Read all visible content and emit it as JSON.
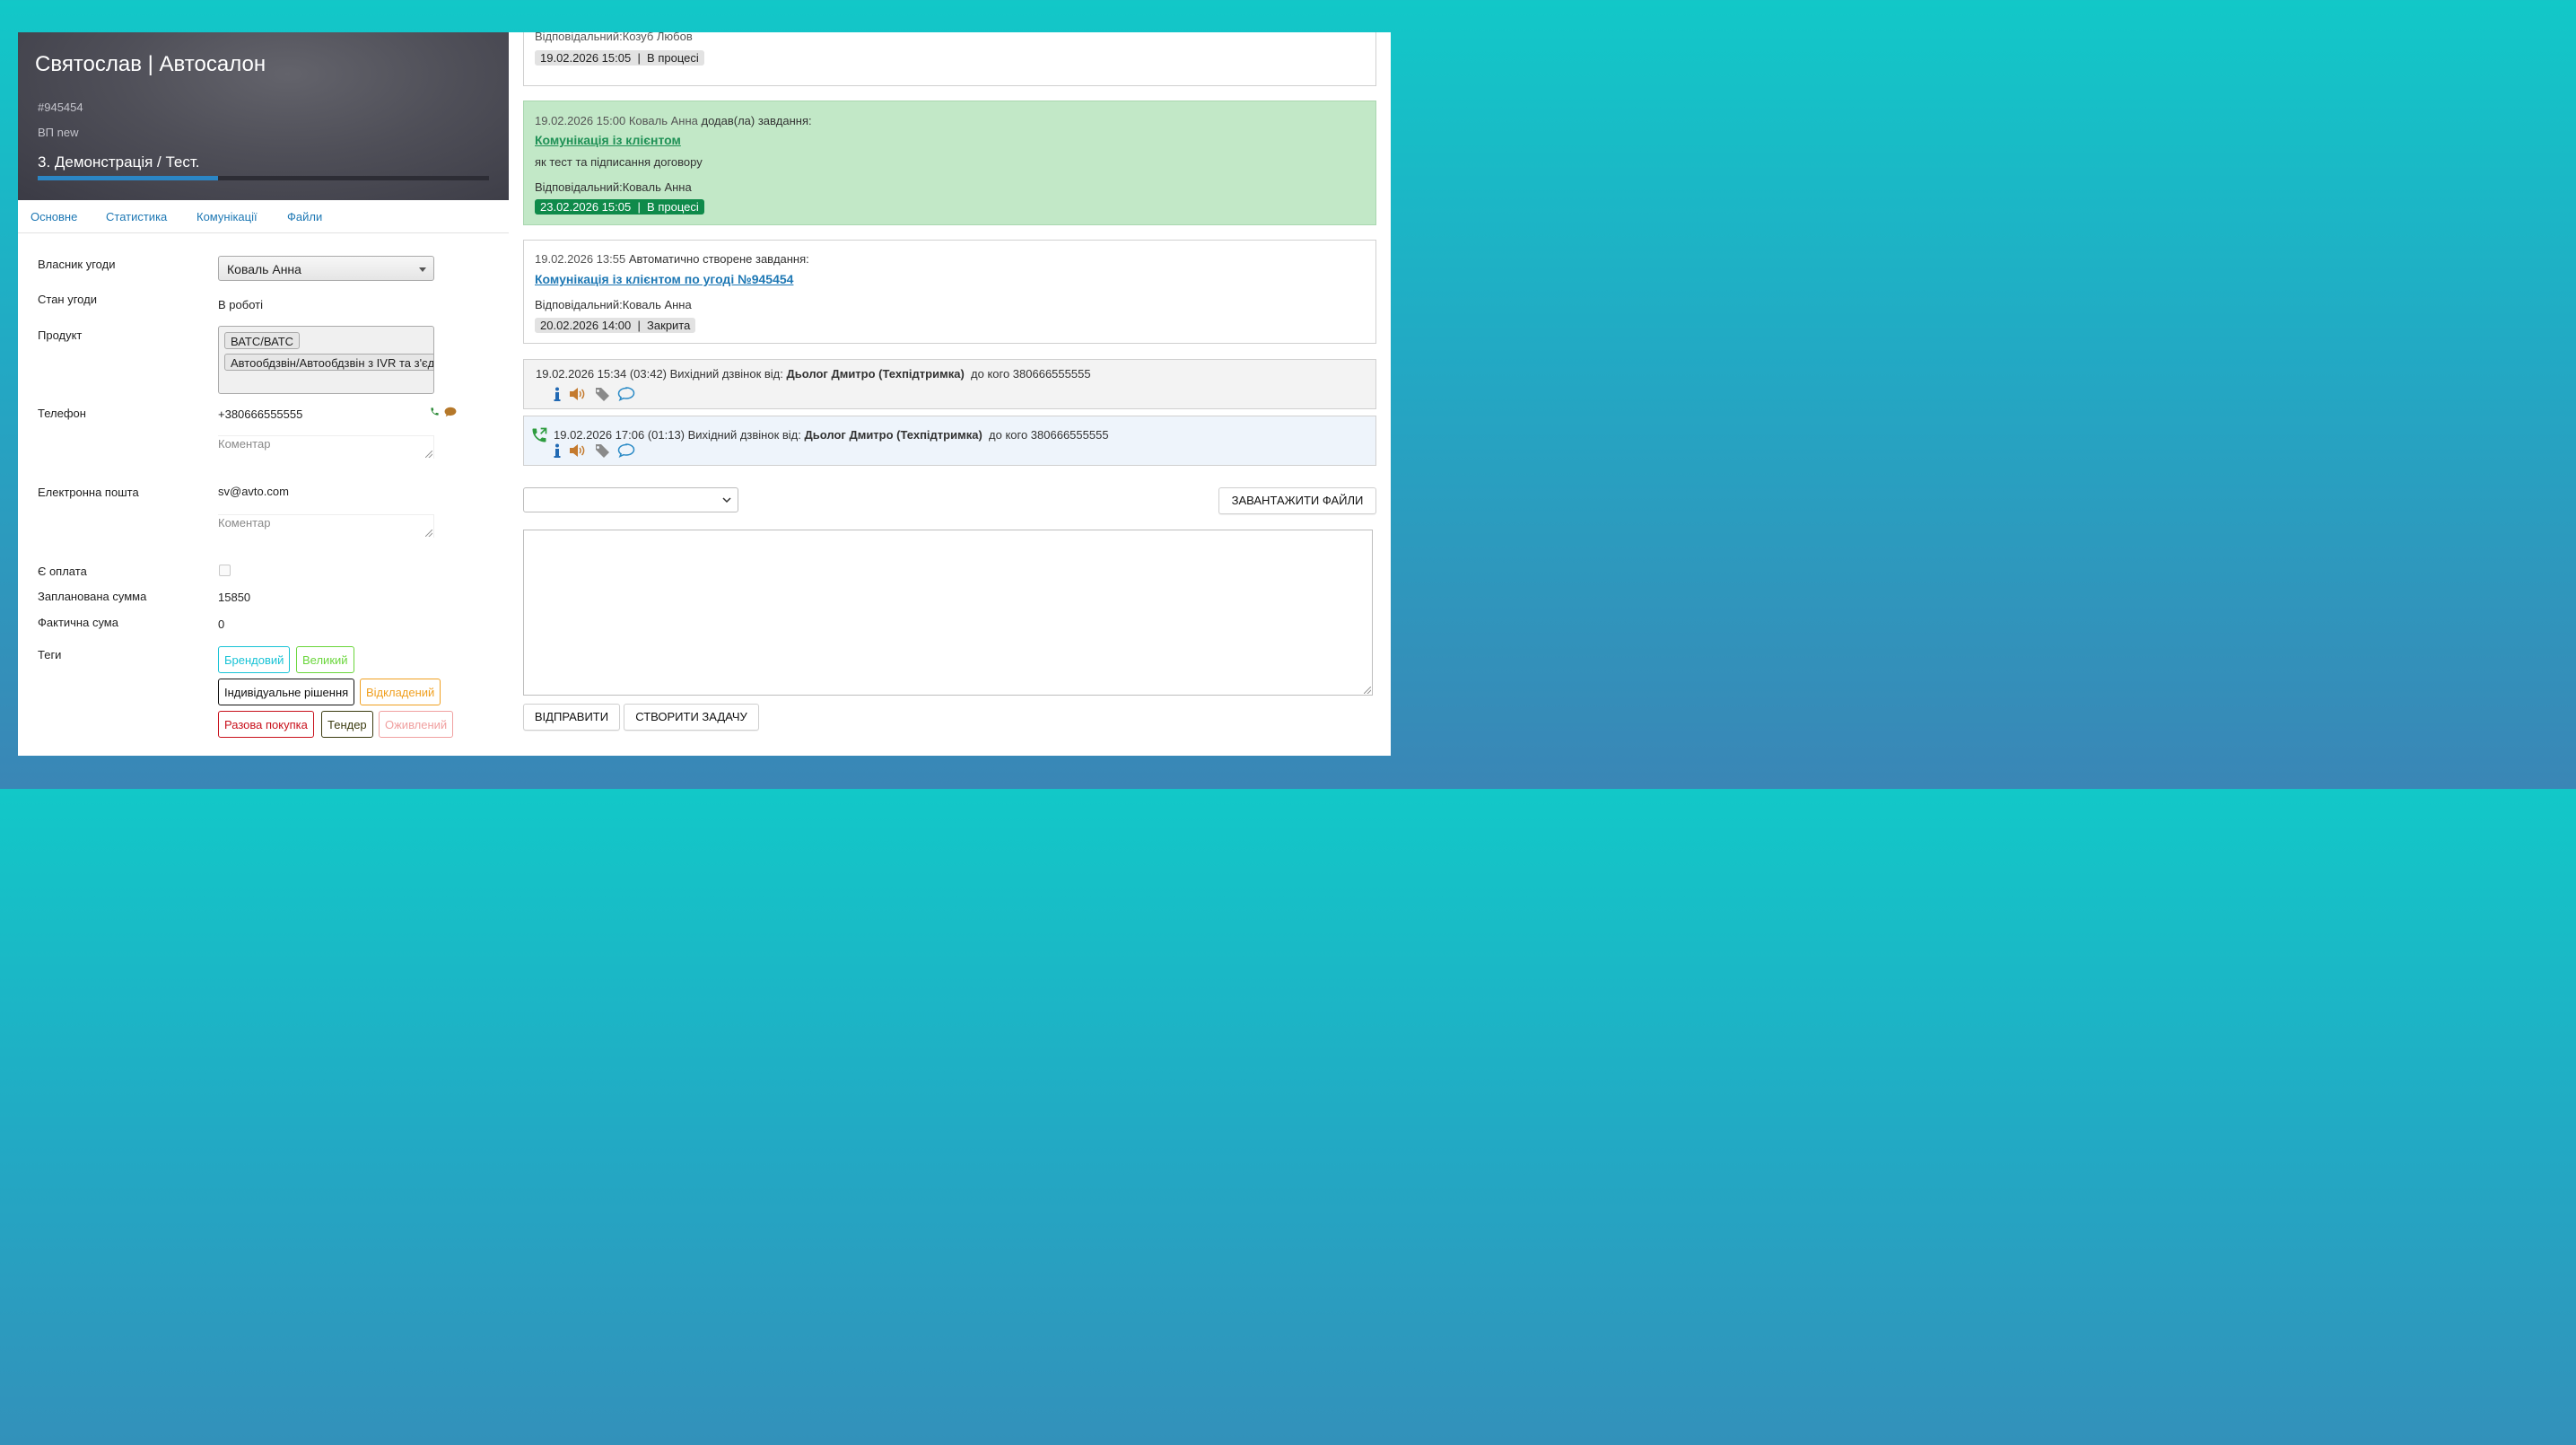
{
  "deal": {
    "title": "Святослав | Автосалон",
    "number": "#945454",
    "pipeline": "ВП new",
    "stage": "3. Демонстрація / Тест.",
    "stage_progress": 0.4
  },
  "tabs": [
    "Основне",
    "Статистика",
    "Комунікації",
    "Файли"
  ],
  "fields": {
    "owner_label": "Власник угоди",
    "owner_value": "Коваль Анна",
    "state_label": "Стан угоди",
    "state_value": "В роботі",
    "product_label": "Продукт",
    "products": [
      "ВАТС/ВАТС",
      "Автообдзвін/Автообдзвін з IVR та з'єднанням"
    ],
    "phone_label": "Телефон",
    "phone_value": "+380666555555",
    "comment_placeholder": "Коментар",
    "email_label": "Електронна пошта",
    "email_value": "sv@avto.com",
    "payment_label": "Є оплата",
    "payment_checked": false,
    "planned_label": "Запланована сумма",
    "planned_value": "15850",
    "actual_label": "Фактична сума",
    "actual_value": "0",
    "tags_label": "Теги"
  },
  "tags": [
    {
      "label": "Брендовий",
      "color": "#19c3d6"
    },
    {
      "label": "Великий",
      "color": "#6ad63b"
    },
    {
      "label": "Індивідуальне рішення",
      "color": "#111111"
    },
    {
      "label": "Відкладений",
      "color": "#f0a020"
    },
    {
      "label": "Разова покупка",
      "color": "#c8111c"
    },
    {
      "label": "Тендер",
      "color": "#3b3b10"
    },
    {
      "label": "Оживлений",
      "color": "#f0a0a0"
    }
  ],
  "feed": {
    "task0": {
      "responsible": "Відповідальний:Козуб Любов",
      "due": "19.02.2026 15:05",
      "status": "В процесі"
    },
    "task1": {
      "datetime": "19.02.2026 15:00",
      "author": "Коваль Анна",
      "action": "додав(ла) завдання:",
      "title": "Комунікація із клієнтом",
      "description": "як тест та підписання договору",
      "responsible": "Відповідальний:Коваль Анна",
      "due": "23.02.2026 15:05",
      "status": "В процесі"
    },
    "task2": {
      "datetime": "19.02.2026 13:55",
      "action": "Автоматично створене завдання:",
      "title": "Комунікація із клієнтом по угоді №945454",
      "responsible": "Відповідальний:Коваль Анна",
      "due": "20.02.2026 14:00",
      "status": "Закрита"
    },
    "call1": {
      "text": "19.02.2026 15:34 (03:42) Вихідний дзвінок від:",
      "who": "Дьолог Дмитро (Техпідтримка)",
      "to": "до кого 380666555555"
    },
    "call2": {
      "text": "19.02.2026 17:06 (01:13) Вихідний дзвінок від:",
      "who": "Дьолог Дмитро (Техпідтримка)",
      "to": "до кого 380666555555"
    }
  },
  "composer": {
    "select_value": "",
    "upload_label": "ЗАВАНТАЖИТИ ФАЙЛИ",
    "message": "",
    "send_label": "ВІДПРАВИТИ",
    "task_label": "СТВОРИТИ ЗАДАЧУ"
  },
  "colors": {
    "link": "#1e78b4",
    "green_card": "#c2e8c7",
    "green_pill": "#0f8a4a",
    "call_blue": "#eef4fb"
  }
}
